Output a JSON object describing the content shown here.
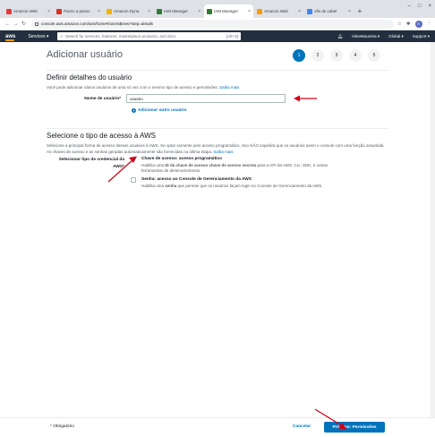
{
  "browser": {
    "tabs": [
      {
        "label": "Amazon Web",
        "color": "#e53935",
        "active": false
      },
      {
        "label": "Passo a passo",
        "color": "#d93025",
        "active": false
      },
      {
        "label": "Amazon Dyna",
        "color": "#f4b400",
        "active": false
      },
      {
        "label": "IAM Manager",
        "color": "#2e7d32",
        "active": false
      },
      {
        "label": "IAM Manager",
        "color": "#2e7d32",
        "active": true
      },
      {
        "label": "Amazon Web",
        "color": "#ff9900",
        "active": false
      },
      {
        "label": "ofis de cabel",
        "color": "#4285f4",
        "active": false
      }
    ],
    "url": "console.aws.amazon.com/iam/home#/users$new?step=details",
    "avatar_letter": "A"
  },
  "aws_nav": {
    "logo": "aws",
    "services": "Services ▾",
    "search_placeholder": "Search for services, features, marketplace products, and docs",
    "search_shortcut": "[Alt+S]",
    "account": "AlineMoureira ▾",
    "region": "Global ▾",
    "support": "Support ▾"
  },
  "page": {
    "title": "Adicionar usuário",
    "steps": [
      "1",
      "2",
      "3",
      "4",
      "5"
    ],
    "active_step": 0
  },
  "user_details": {
    "heading": "Definir detalhes do usuário",
    "description": "Você pode adicionar vários usuários de uma só vez com o mesmo tipo de acesso e permissões.",
    "learn_more": "Saiba mais",
    "username_label": "Nome de usuário*",
    "username_value": "usuario",
    "add_another": "Adicionar outro usuário"
  },
  "access_type": {
    "heading": "Selecione o tipo de acesso à AWS",
    "description": "Selecione a principal forma de acesso desses usuários à AWS. Se optar somente pelo acesso programático, isso NÃO impedirá que os usuários usem o console com uma função assumida. As chaves de acesso e as senhas geradas automaticamente são fornecidas na última etapa.",
    "learn_more": "Saiba mais",
    "credential_label": "Selecionar tipo de credencial da AWS*",
    "options": [
      {
        "title": "Chave de acesso: acesso programático",
        "desc_pre": "Habilita uma ",
        "desc_bold": "ID da chave de acesso chave de acesso secreta",
        "desc_post": " para a API da AWS, CLI, SDK, e outras ferramentas de desenvolvimento.",
        "checked": true
      },
      {
        "title": "Senha: acesso ao Console de Gerenciamento da AWS",
        "desc_pre": "Habilita uma ",
        "desc_bold": "senha",
        "desc_post": " que permite que os usuários façam login no Console de Gerenciamento da AWS.",
        "checked": false
      }
    ]
  },
  "footer": {
    "required_note": "* Obrigatório",
    "cancel": "Cancelar",
    "next": "Próximo: Permissões"
  },
  "colors": {
    "aws_nav_bg": "#232f3e",
    "primary": "#0073bb",
    "annotation_arrow": "#d0021b"
  }
}
